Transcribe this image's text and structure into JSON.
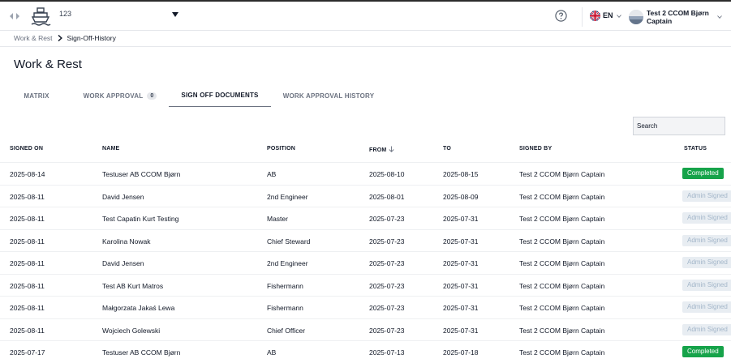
{
  "topbar": {
    "vessel": "123",
    "language": "EN",
    "user_name": "Test 2 CCOM Bjørn Captain"
  },
  "breadcrumb": {
    "parent": "Work & Rest",
    "current": "Sign-Off-History"
  },
  "page_title": "Work & Rest",
  "tabs": [
    {
      "label": "MATRIX"
    },
    {
      "label": "WORK APPROVAL",
      "badge": "0"
    },
    {
      "label": "SIGN OFF DOCUMENTS",
      "active": true
    },
    {
      "label": "WORK APPROVAL HISTORY"
    }
  ],
  "search": {
    "placeholder": "Search"
  },
  "table": {
    "columns": [
      "SIGNED ON",
      "NAME",
      "POSITION",
      "FROM",
      "TO",
      "SIGNED BY",
      "STATUS"
    ],
    "rows": [
      {
        "signed_on": "2025-08-14",
        "name": "Testuser AB CCOM Bjørn",
        "position": "AB",
        "from": "2025-08-10",
        "to": "2025-08-15",
        "signed_by": "Test 2 CCOM Bjørn Captain",
        "status": "Completed"
      },
      {
        "signed_on": "2025-08-11",
        "name": "David Jensen",
        "position": "2nd Engineer",
        "from": "2025-08-01",
        "to": "2025-08-09",
        "signed_by": "Test 2 CCOM Bjørn Captain",
        "status": "Admin Signed"
      },
      {
        "signed_on": "2025-08-11",
        "name": "Test Capatin Kurt Testing",
        "position": "Master",
        "from": "2025-07-23",
        "to": "2025-07-31",
        "signed_by": "Test 2 CCOM Bjørn Captain",
        "status": "Admin Signed"
      },
      {
        "signed_on": "2025-08-11",
        "name": "Karolina Nowak",
        "position": "Chief Steward",
        "from": "2025-07-23",
        "to": "2025-07-31",
        "signed_by": "Test 2 CCOM Bjørn Captain",
        "status": "Admin Signed"
      },
      {
        "signed_on": "2025-08-11",
        "name": "David Jensen",
        "position": "2nd Engineer",
        "from": "2025-07-23",
        "to": "2025-07-31",
        "signed_by": "Test 2 CCOM Bjørn Captain",
        "status": "Admin Signed"
      },
      {
        "signed_on": "2025-08-11",
        "name": "Test AB Kurt Matros",
        "position": "Fishermann",
        "from": "2025-07-23",
        "to": "2025-07-31",
        "signed_by": "Test 2 CCOM Bjørn Captain",
        "status": "Admin Signed"
      },
      {
        "signed_on": "2025-08-11",
        "name": "Małgorzata Jakaś Lewa",
        "position": "Fishermann",
        "from": "2025-07-23",
        "to": "2025-07-31",
        "signed_by": "Test 2 CCOM Bjørn Captain",
        "status": "Admin Signed"
      },
      {
        "signed_on": "2025-08-11",
        "name": "Wojciech Golewski",
        "position": "Chief Officer",
        "from": "2025-07-23",
        "to": "2025-07-31",
        "signed_by": "Test 2 CCOM Bjørn Captain",
        "status": "Admin Signed"
      },
      {
        "signed_on": "2025-07-17",
        "name": "Testuser AB CCOM Bjørn",
        "position": "AB",
        "from": "2025-07-13",
        "to": "2025-07-18",
        "signed_by": "Test 2 CCOM Bjørn Captain",
        "status": "Completed"
      }
    ]
  }
}
